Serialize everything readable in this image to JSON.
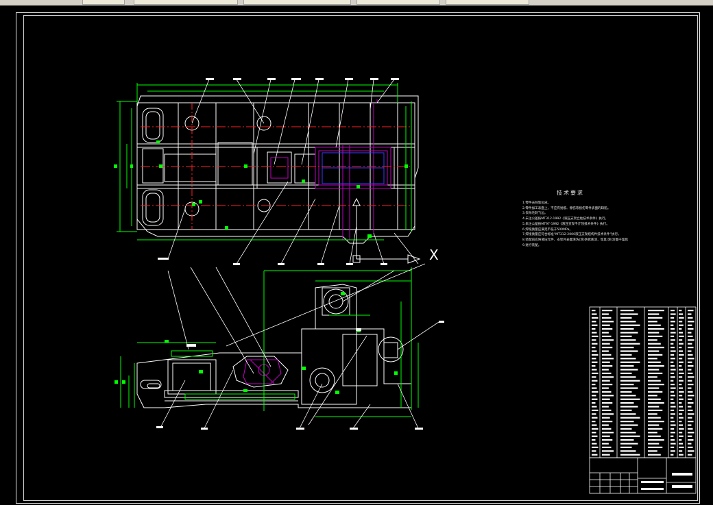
{
  "drawing": {
    "tech_requirements": {
      "title": "技术要求",
      "lines": [
        "1.零件去除氧化皮。",
        "2.零件加工表面上，不应有划痕、擦伤等损伤零件表面的缺陷。",
        "3.去除毛刺飞边。",
        "4.未注公差按MT312-1992《液压支架立柱技术条件》执行。",
        "5.未注公差按MT97-1992《液压支架千斤顶技术条件》执行。",
        "6.焊缝质量应满足不低于500MPa。",
        "7.焊接质量应符合标准“MT312-2000液压支架结构件技术条件”执行。",
        "8.装配前应将液压元件、支架外表面清洗(涂)防锈底漆，等其(涂)漆面干燥后",
        "9.进行装配。"
      ]
    },
    "axis_marker": "X"
  },
  "colors": {
    "background": "#000000",
    "outline": "#ffffff",
    "dimension": "#00ff00",
    "centerline": "#ff2020",
    "part": "#b000b0",
    "hidden": "#3a3aff"
  }
}
